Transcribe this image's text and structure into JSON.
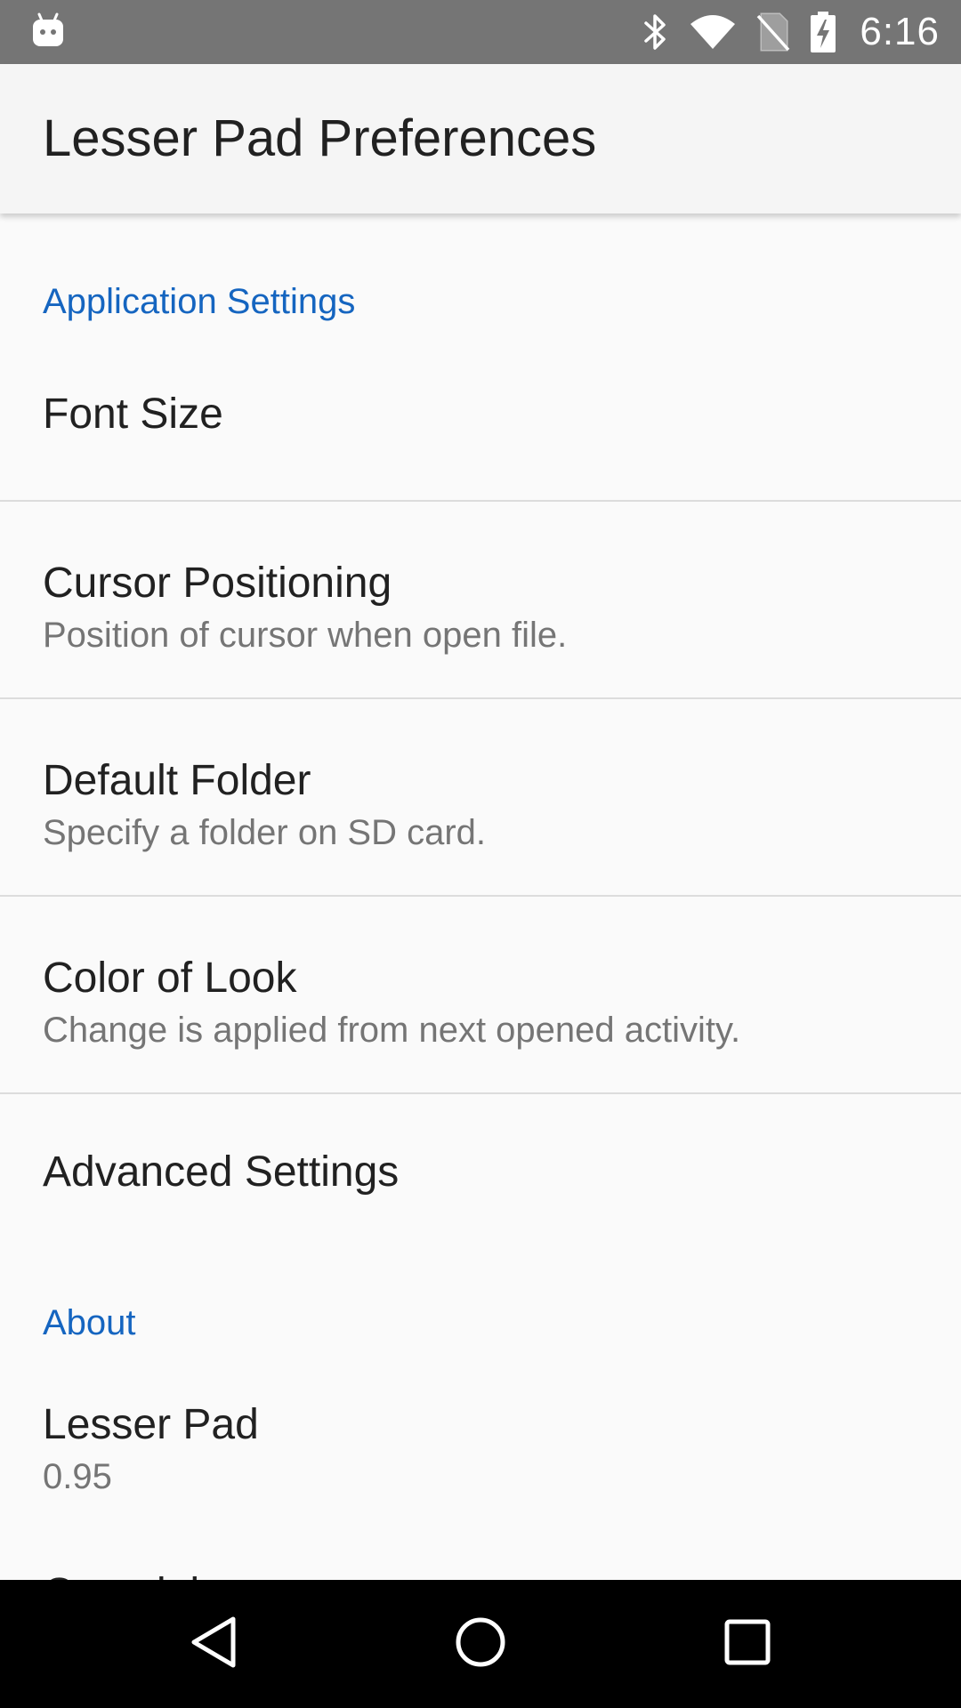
{
  "status_bar": {
    "time": "6:16",
    "icons": [
      "android-debug-icon",
      "bluetooth-icon",
      "wifi-icon",
      "no-sim-icon",
      "battery-charging-icon"
    ]
  },
  "app_bar": {
    "title": "Lesser Pad Preferences"
  },
  "categories": {
    "application_settings": "Application Settings",
    "about": "About"
  },
  "preferences": {
    "font_size": {
      "title": "Font Size"
    },
    "cursor_positioning": {
      "title": "Cursor Positioning",
      "summary": "Position of cursor when open file."
    },
    "default_folder": {
      "title": "Default Folder",
      "summary": "Specify a folder on SD card."
    },
    "color_of_look": {
      "title": "Color of Look",
      "summary": "Change is applied from next opened activity."
    },
    "advanced_settings": {
      "title": "Advanced Settings"
    },
    "lesser_pad": {
      "title": "Lesser Pad",
      "summary": "0.95"
    },
    "copyright": {
      "title": "Copyright"
    }
  },
  "nav_bar": {
    "icons": [
      "back-icon",
      "home-icon",
      "recents-icon"
    ]
  },
  "colors": {
    "status_bar": "#757575",
    "app_bar": "#f5f5f5",
    "accent": "#1565c0",
    "background": "#fafafa",
    "nav_bar": "#000000"
  }
}
